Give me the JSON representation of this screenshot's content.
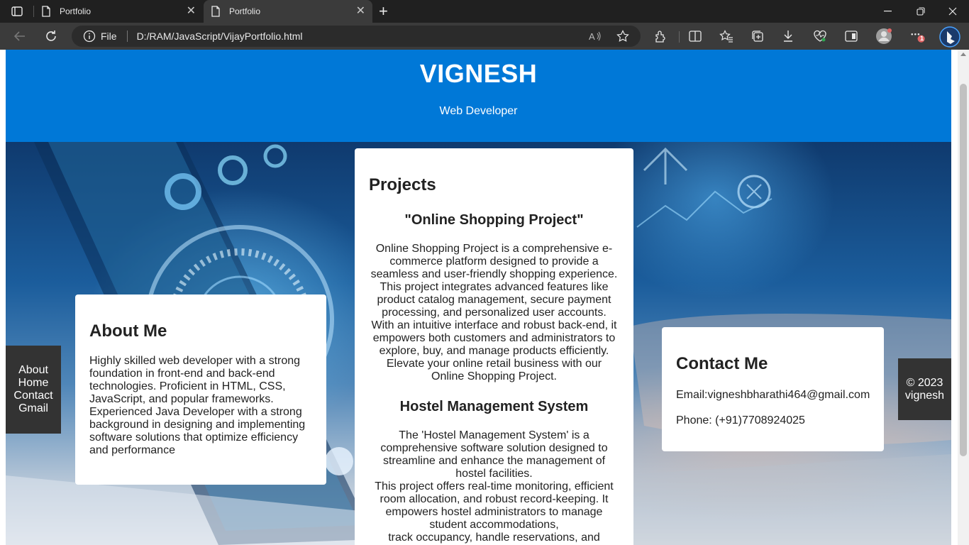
{
  "browser": {
    "tabs": [
      {
        "title": "Portfolio",
        "active": false
      },
      {
        "title": "Portfolio",
        "active": true
      }
    ],
    "address": {
      "scheme_label": "File",
      "url": "D:/RAM/JavaScript/VijayPortfolio.html"
    },
    "notification_badge": "1",
    "icons": [
      "tab-actions-icon",
      "page-icon",
      "close-icon",
      "new-tab-icon",
      "minimize-icon",
      "restore-icon",
      "window-close-icon",
      "back-icon",
      "refresh-icon",
      "info-icon",
      "read-aloud-icon",
      "favorite-icon",
      "extensions-icon",
      "split-screen-icon",
      "favorites-icon",
      "collections-icon",
      "downloads-icon",
      "performance-icon",
      "sidebar-icon",
      "profile-icon",
      "more-icon",
      "bing-icon"
    ]
  },
  "header": {
    "name": "VIGNESH",
    "role": "Web Developer"
  },
  "nav": {
    "items": [
      "About",
      "Home",
      "Contact",
      "Gmail"
    ]
  },
  "about": {
    "title": "About Me",
    "body": "Highly skilled web developer with a strong foundation in front-end and back-end technologies. Proficient in HTML, CSS, JavaScript, and popular frameworks. Experienced Java Developer with a strong background in designing and implementing software solutions that optimize efficiency and performance"
  },
  "projects": {
    "title": "Projects",
    "items": [
      {
        "name": "\"Online Shopping Project\"",
        "description": "Online Shopping Project is a comprehensive e-commerce platform designed to provide a seamless and user-friendly shopping experience. This project integrates advanced features like product catalog management, secure payment processing, and personalized user accounts. With an intuitive interface and robust back-end, it empowers both customers and administrators to explore, buy, and manage products efficiently. Elevate your online retail business with our Online Shopping Project."
      },
      {
        "name": "Hostel Management System",
        "description": "The 'Hostel Management System' is a comprehensive software solution designed to streamline and enhance the management of hostel facilities.\nThis project offers real-time monitoring, efficient room allocation, and robust record-keeping. It empowers hostel administrators to manage student accommodations,\ntrack occupancy, handle reservations, and generate reports with ease. With user-friendly"
      }
    ]
  },
  "contact": {
    "title": "Contact Me",
    "email": "Email:vigneshbharathi464@gmail.com",
    "phone": "Phone: (+91)7708924025"
  },
  "footer": {
    "year": "© 2023",
    "name": "vignesh"
  },
  "colors": {
    "header_bg": "#0078d7",
    "panel_dark": "#333333",
    "card_bg": "#ffffff"
  }
}
